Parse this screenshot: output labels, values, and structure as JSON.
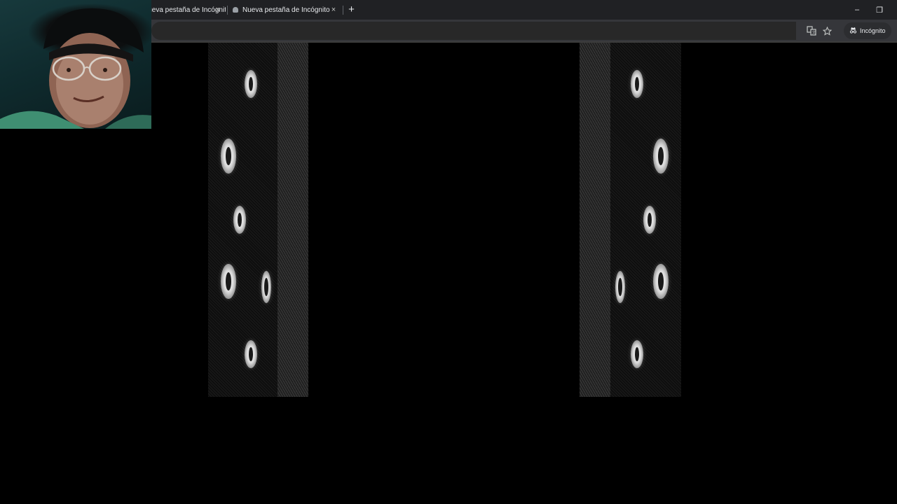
{
  "browser": {
    "tabs": [
      {
        "title": "Nueva pestaña de Incógnito",
        "active": false,
        "close_label": "×"
      },
      {
        "title": "Nueva pestaña de Incógnito",
        "active": true,
        "close_label": "×"
      }
    ],
    "new_tab_label": "+",
    "window_controls": {
      "minimize": "–",
      "restore": "❐"
    },
    "toolbar": {
      "translate_icon": "translate-icon",
      "bookmark_icon": "star-icon",
      "profile_label": "Incógnito"
    }
  },
  "colors": {
    "tabstrip_bg": "#202124",
    "toolbar_bg": "#35363a",
    "page_bg": "#000000"
  }
}
